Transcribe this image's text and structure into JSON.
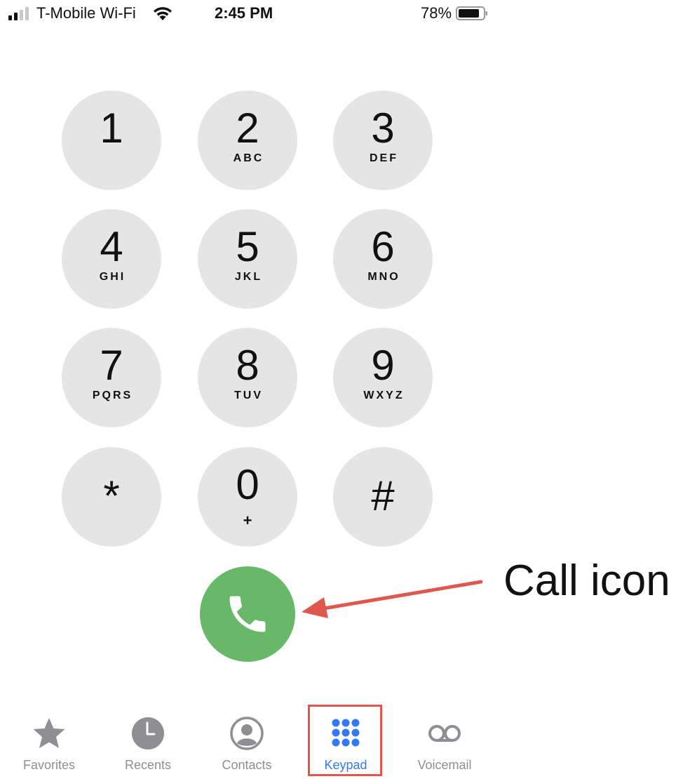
{
  "status_bar": {
    "carrier": "T-Mobile Wi-Fi",
    "time": "2:45 PM",
    "battery_percent": "78%",
    "signal_icon": "signal-bars-icon",
    "wifi_icon": "wifi-icon",
    "battery_icon": "battery-icon"
  },
  "keypad": {
    "keys": [
      {
        "digit": "1",
        "letters": ""
      },
      {
        "digit": "2",
        "letters": "ABC"
      },
      {
        "digit": "3",
        "letters": "DEF"
      },
      {
        "digit": "4",
        "letters": "GHI"
      },
      {
        "digit": "5",
        "letters": "JKL"
      },
      {
        "digit": "6",
        "letters": "MNO"
      },
      {
        "digit": "7",
        "letters": "PQRS"
      },
      {
        "digit": "8",
        "letters": "TUV"
      },
      {
        "digit": "9",
        "letters": "WXYZ"
      },
      {
        "digit": "*",
        "letters": ""
      },
      {
        "digit": "0",
        "letters": "+"
      },
      {
        "digit": "#",
        "letters": ""
      }
    ]
  },
  "call_button": {
    "icon": "phone-icon",
    "color": "#67b868"
  },
  "annotation": {
    "label": "Call icon",
    "color": "#e0574f"
  },
  "tab_bar": {
    "active_color": "#3478f6",
    "inactive_color": "#8e8e93",
    "tabs": [
      {
        "label": "Favorites",
        "icon": "star-icon"
      },
      {
        "label": "Recents",
        "icon": "clock-icon"
      },
      {
        "label": "Contacts",
        "icon": "person-circle-icon"
      },
      {
        "label": "Keypad",
        "icon": "keypad-grid-icon",
        "selected": true
      },
      {
        "label": "Voicemail",
        "icon": "voicemail-icon"
      }
    ]
  }
}
